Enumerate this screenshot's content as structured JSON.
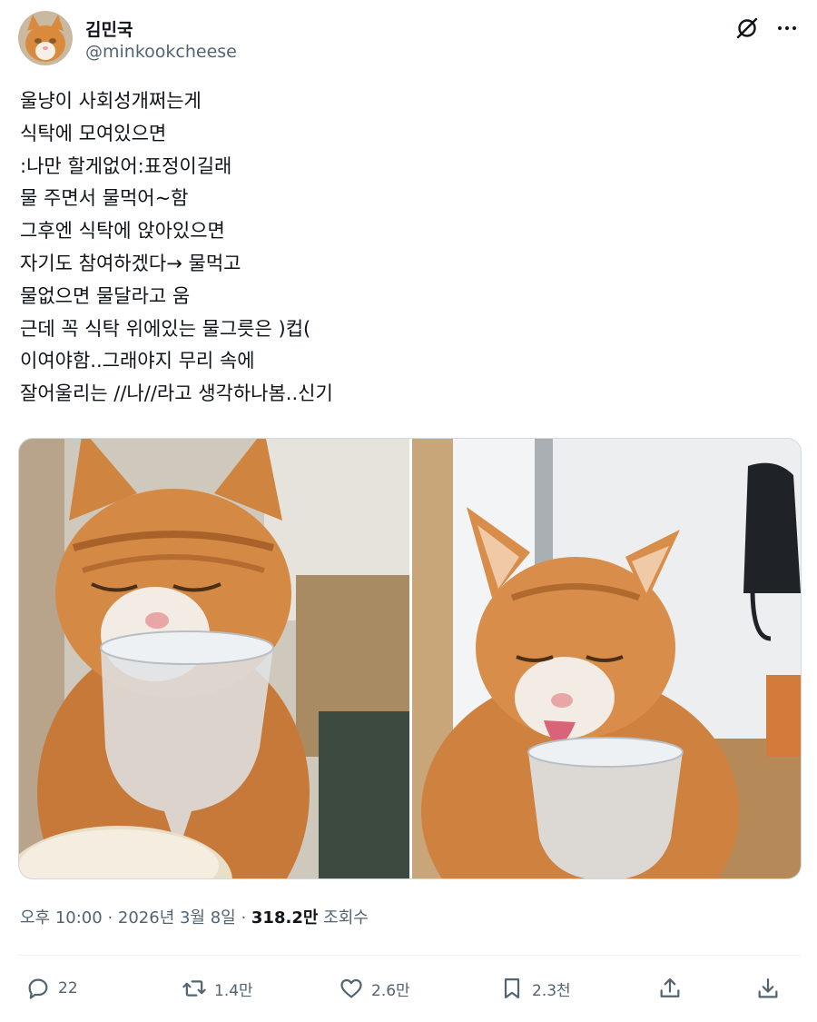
{
  "author": {
    "display_name": "김민국",
    "handle": "@minkookcheese",
    "avatar_icon": "cat-avatar"
  },
  "header_icons": {
    "grok": "grok-icon",
    "more": "more-icon"
  },
  "tweet": {
    "lines": [
      "울냥이 사회성개쩌는게",
      "식탁에 모여있으면",
      ":나만 할게없어:표정이길래",
      "물 주면서 물먹어~함",
      "그후엔 식탁에 앉아있으면",
      "자기도 참여하겠다→ 물먹고",
      "물없으면 물달라고 움",
      "근데 꼭 식탁 위에있는 물그릇은 )컵(",
      "이여야함..그래야지 무리 속에",
      "잘어울리는 //나//라고 생각하나봄..신기"
    ]
  },
  "media": {
    "photos": [
      {
        "subject": "orange tabby cat with eyes closed behind crystal glass"
      },
      {
        "subject": "orange tabby cat licking water from crystal glass"
      }
    ]
  },
  "meta": {
    "time": "오후 10:00",
    "separator": " · ",
    "date": "2026년 3월 8일",
    "separator2": " · ",
    "views_count": "318.2만",
    "views_label": " 조회수"
  },
  "actions": {
    "reply_count": "22",
    "retweet_count": "1.4만",
    "like_count": "2.6만",
    "bookmark_count": "2.3천"
  },
  "colors": {
    "text_primary": "#0f1419",
    "text_secondary": "#536471",
    "border": "#cfd9de"
  }
}
